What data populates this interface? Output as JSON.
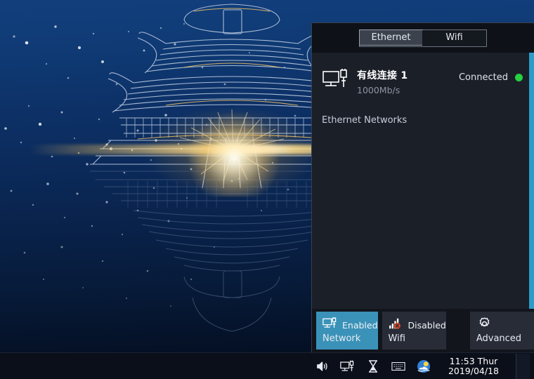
{
  "desktop": {
    "wallpaper_name": "temple-of-heaven-starry-night",
    "colors": {
      "sky_top": "#123f7d",
      "sky_bottom": "#040e20",
      "line_art": "#aebfd8",
      "glow": "#ffd978",
      "accent_blue": "#3a92b8",
      "status_green": "#27d140",
      "panel_bg": "#12151c",
      "panel_body_bg": "#1b1f28"
    }
  },
  "panel": {
    "tabs": [
      {
        "label": "Ethernet",
        "active": true
      },
      {
        "label": "Wifi",
        "active": false
      }
    ],
    "connection": {
      "icon": "wired-network-icon",
      "name": "有线连接 1",
      "speed": "1000Mb/s",
      "status": "Connected",
      "status_indicator": "green-dot"
    },
    "section_label": "Ethernet Networks",
    "scrollbar": {
      "name": "vertical-scrollbar",
      "position": "right"
    },
    "buttons": [
      {
        "icon": "wired-network-icon",
        "state": "Enabled",
        "name": "Network",
        "active": true
      },
      {
        "icon": "wifi-disabled-icon",
        "state": "Disabled",
        "name": "Wifi",
        "active": false
      },
      {
        "icon": "gear-icon",
        "state": "",
        "name": "Advanced",
        "active": false
      }
    ]
  },
  "taskbar": {
    "tray_icons": [
      "volume-icon",
      "network-icon",
      "hourglass-icon",
      "keyboard-icon",
      "weather-icon"
    ],
    "clock": {
      "time": "11:53 Thur",
      "date": "2019/04/18"
    },
    "show_desktop": "show-desktop-button"
  }
}
